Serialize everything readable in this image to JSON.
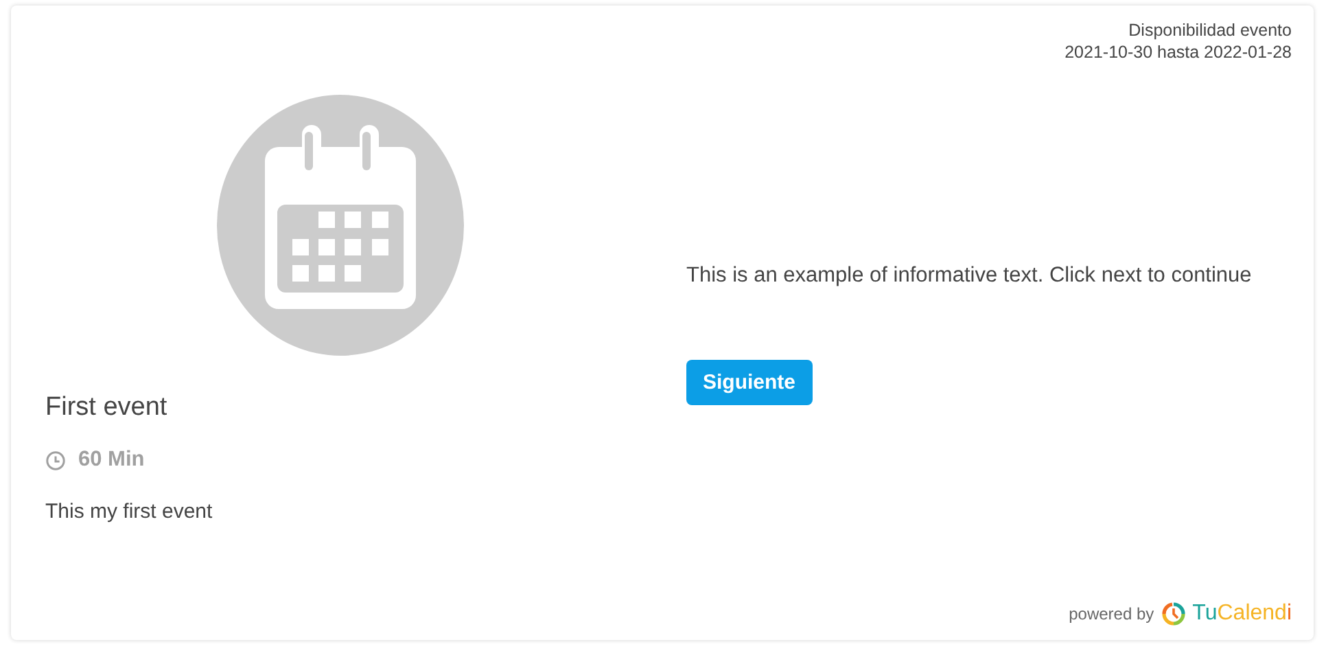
{
  "availability": {
    "label": "Disponibilidad evento",
    "range": "2021-10-30 hasta 2022-01-28"
  },
  "event": {
    "title": "First event",
    "duration": "60 Min",
    "description": "This my first event"
  },
  "info_text": "This is an example of informative text. Click next to continue",
  "next_button": "Siguiente",
  "footer": {
    "powered_by": "powered by",
    "logo_parts": [
      {
        "text": "Tu",
        "color": "#1aa39a"
      },
      {
        "text": "Calend",
        "color": "#f5b324"
      },
      {
        "text": "i",
        "color": "#f06d22"
      }
    ]
  }
}
